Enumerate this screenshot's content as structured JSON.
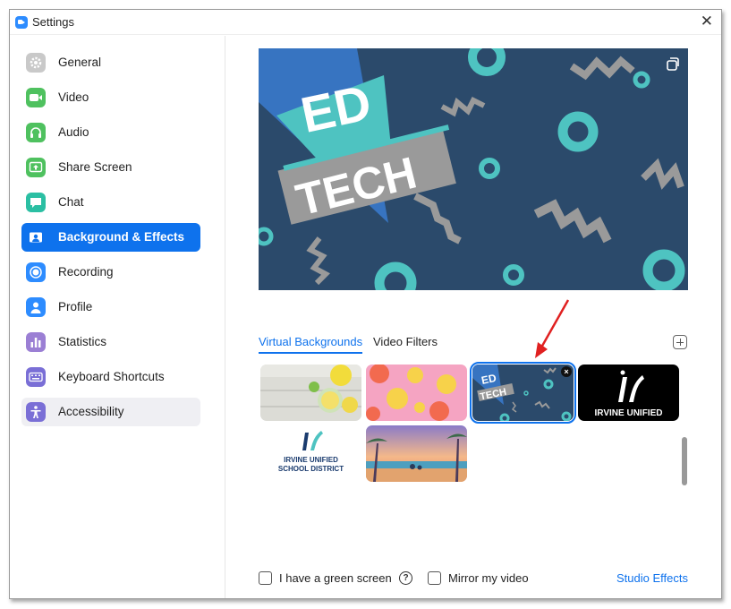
{
  "window": {
    "title": "Settings",
    "close_glyph": "✕"
  },
  "sidebar": {
    "items": [
      {
        "label": "General",
        "icon": "gear-icon",
        "color": "#c9c9c9",
        "state": "normal"
      },
      {
        "label": "Video",
        "icon": "video-camera-icon",
        "color": "#4fc15f",
        "state": "normal"
      },
      {
        "label": "Audio",
        "icon": "headphones-icon",
        "color": "#4fc15f",
        "state": "normal"
      },
      {
        "label": "Share Screen",
        "icon": "share-screen-icon",
        "color": "#4fc15f",
        "state": "normal"
      },
      {
        "label": "Chat",
        "icon": "chat-bubble-icon",
        "color": "#2bbfa3",
        "state": "normal"
      },
      {
        "label": "Background & Effects",
        "icon": "person-card-icon",
        "color": "#0e72ed",
        "state": "active"
      },
      {
        "label": "Recording",
        "icon": "record-icon",
        "color": "#2d8cff",
        "state": "normal"
      },
      {
        "label": "Profile",
        "icon": "profile-icon",
        "color": "#2d8cff",
        "state": "normal"
      },
      {
        "label": "Statistics",
        "icon": "bar-chart-icon",
        "color": "#9b7fd4",
        "state": "normal"
      },
      {
        "label": "Keyboard Shortcuts",
        "icon": "keyboard-icon",
        "color": "#7a6fd6",
        "state": "normal"
      },
      {
        "label": "Accessibility",
        "icon": "accessibility-icon",
        "color": "#7a6fd6",
        "state": "hover"
      }
    ]
  },
  "preview": {
    "image": "ed-tech-background",
    "text_line1": "ED",
    "text_line2": "TECH",
    "toggle_icon": "swap-camera-icon"
  },
  "tabs": [
    {
      "label": "Virtual Backgrounds",
      "active": true
    },
    {
      "label": "Video Filters",
      "active": false
    }
  ],
  "add_background_icon": "plus-square-icon",
  "thumbnails": [
    {
      "name": "lemons-on-wood",
      "selected": false
    },
    {
      "name": "citrus-on-pink",
      "selected": false
    },
    {
      "name": "ed-tech",
      "selected": true,
      "line1": "ED",
      "line2": "TECH",
      "remove_glyph": "×"
    },
    {
      "name": "irvine-unified-black",
      "selected": false,
      "caption": "IRVINE UNIFIED"
    },
    {
      "name": "irvine-unified-school-district",
      "selected": false,
      "caption_line1": "IRVINE UNIFIED",
      "caption_line2": "SCHOOL DISTRICT"
    },
    {
      "name": "beach-sunset-illustration",
      "selected": false
    }
  ],
  "bottom": {
    "green_screen_label": "I have a green screen",
    "help_glyph": "?",
    "mirror_label": "Mirror my video",
    "studio_effects_label": "Studio Effects"
  },
  "colors": {
    "accent": "#0e72ed",
    "preview_bg": "#2b4a6b",
    "teal": "#4ec3c1"
  }
}
